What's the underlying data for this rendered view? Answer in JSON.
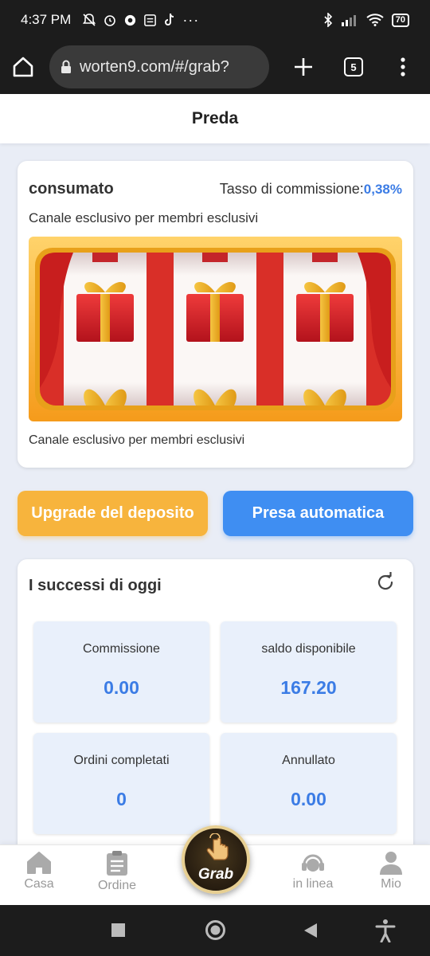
{
  "status_bar": {
    "time": "4:37 PM",
    "battery": "70"
  },
  "browser": {
    "url": "worten9.com/#/grab?",
    "tab_count": "5"
  },
  "header": {
    "title": "Preda"
  },
  "slot_card": {
    "title": "consumato",
    "rate_label": "Tasso di commissione:",
    "rate_value": "0,38%",
    "subtitle": "Canale esclusivo per membri esclusivi",
    "footer": "Canale esclusivo per membri esclusivi"
  },
  "buttons": {
    "deposit": "Upgrade del deposito",
    "auto": "Presa automatica"
  },
  "stats": {
    "title": "I successi di oggi",
    "items": [
      {
        "label": "Commissione",
        "value": "0.00"
      },
      {
        "label": "saldo disponibile",
        "value": "167.20"
      },
      {
        "label": "Ordini completati",
        "value": "0"
      },
      {
        "label": "Annullato",
        "value": "0.00"
      }
    ]
  },
  "bottom_nav": {
    "items": [
      {
        "label": "Casa",
        "icon": "home-icon"
      },
      {
        "label": "Ordine",
        "icon": "clipboard-icon"
      },
      {
        "label": "in linea",
        "icon": "headset-icon"
      },
      {
        "label": "Mio",
        "icon": "user-icon"
      }
    ],
    "grab_label": "Grab"
  },
  "colors": {
    "accent_blue": "#3f8ef2",
    "accent_orange": "#f7b43d",
    "value_blue": "#3b7ce5"
  }
}
